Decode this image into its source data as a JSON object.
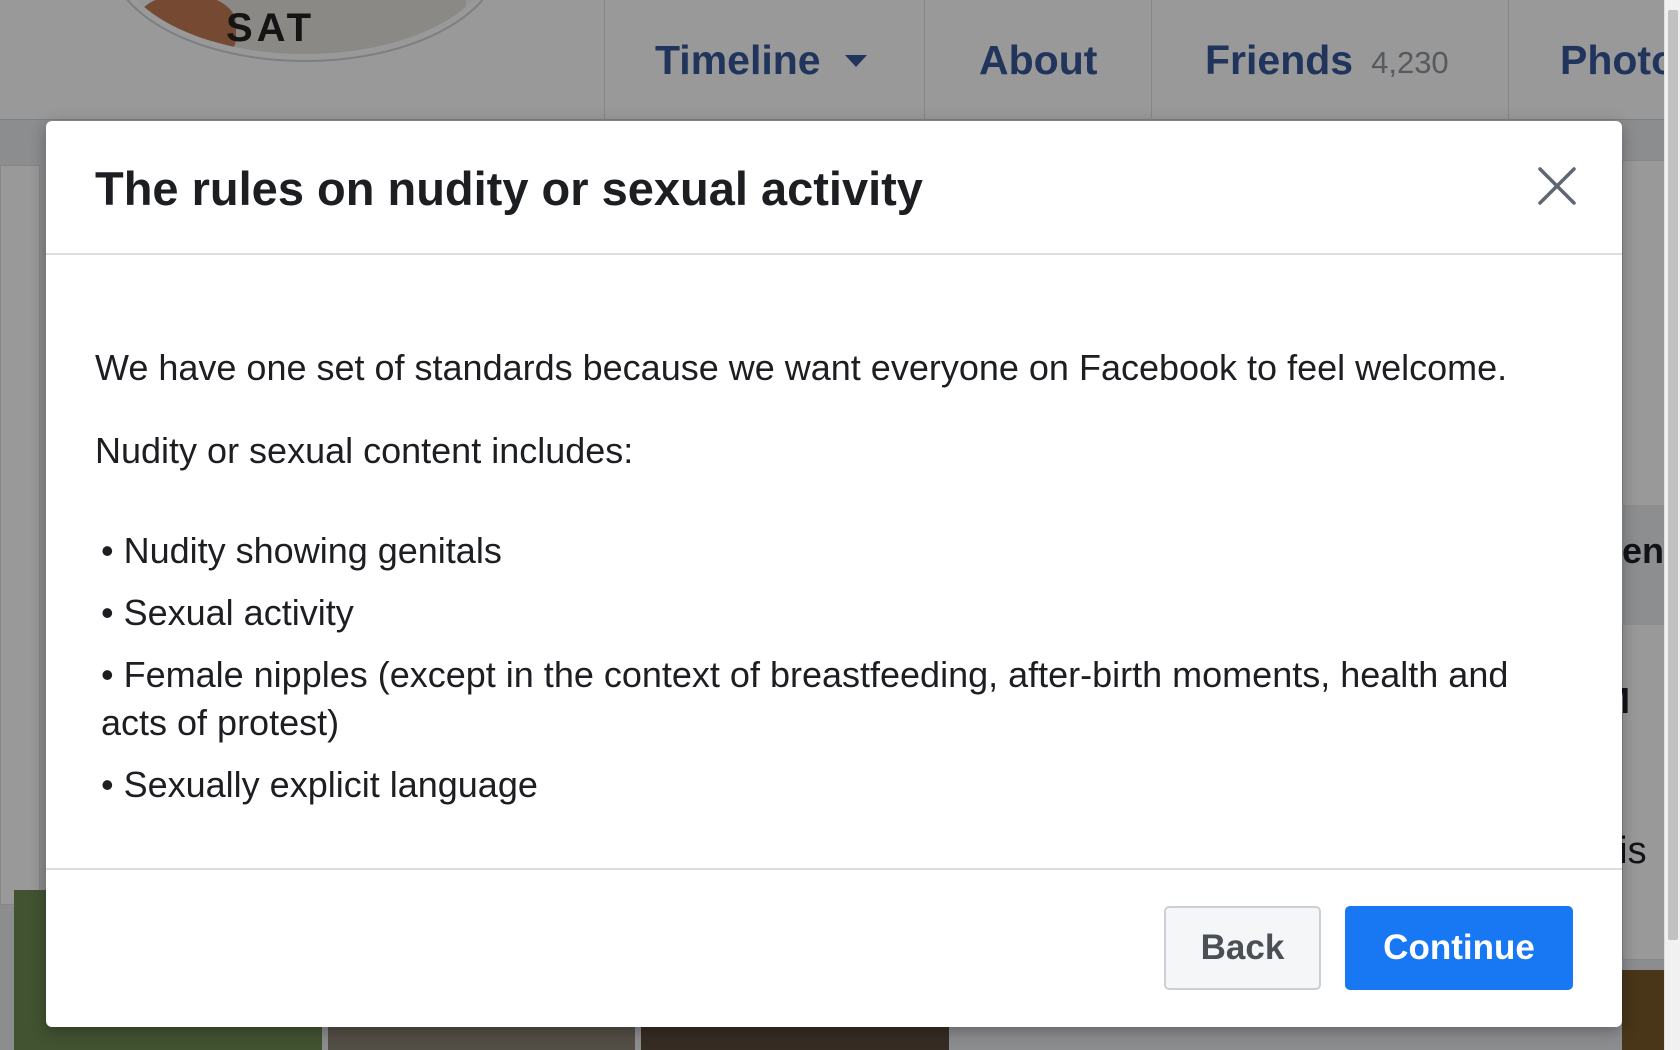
{
  "background": {
    "nav_tabs": [
      {
        "label": "Timeline",
        "count": ""
      },
      {
        "label": "About",
        "count": ""
      },
      {
        "label": "Friends",
        "count": "4,230"
      },
      {
        "label": "Photos",
        "count": ""
      }
    ],
    "avatar_text": "SAT",
    "right_fragments": [
      "rien",
      "M",
      "his"
    ]
  },
  "modal": {
    "title": "The rules on nudity or sexual activity",
    "intro": "We have one set of standards because we want everyone on Facebook to feel welcome.",
    "includes_heading": "Nudity or sexual content includes:",
    "rules": [
      "• Nudity showing genitals",
      "• Sexual activity",
      "• Female nipples (except in the context of breastfeeding, after-birth moments, health and acts of protest)",
      "• Sexually explicit language"
    ],
    "buttons": {
      "back": "Back",
      "continue": "Continue"
    }
  },
  "colors": {
    "primary_button": "#1877f2",
    "nav_link": "#365899",
    "overlay": "rgba(0,0,0,0.4)"
  },
  "icons": {
    "close": "close-icon"
  }
}
